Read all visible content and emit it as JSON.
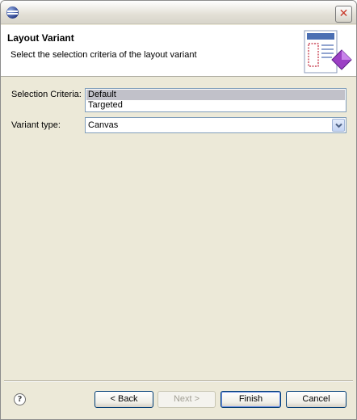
{
  "window": {
    "icons": {
      "app": "eclipse-app-icon",
      "close": "close-x-icon",
      "help": "help-question-icon",
      "wizard": "layout-wizard-graphic"
    },
    "close_glyph": "✕"
  },
  "header": {
    "title": "Layout Variant",
    "description": "Select the selection criteria of the layout variant"
  },
  "form": {
    "selection_criteria_label": "Selection Criteria:",
    "selection_criteria_options": [
      "Default",
      "Targeted"
    ],
    "selection_criteria_selected": "Default",
    "variant_type_label": "Variant type:",
    "variant_type_value": "Canvas"
  },
  "footer": {
    "help_glyph": "?",
    "back_label": "< Back",
    "next_label": "Next >",
    "finish_label": "Finish",
    "cancel_label": "Cancel"
  }
}
